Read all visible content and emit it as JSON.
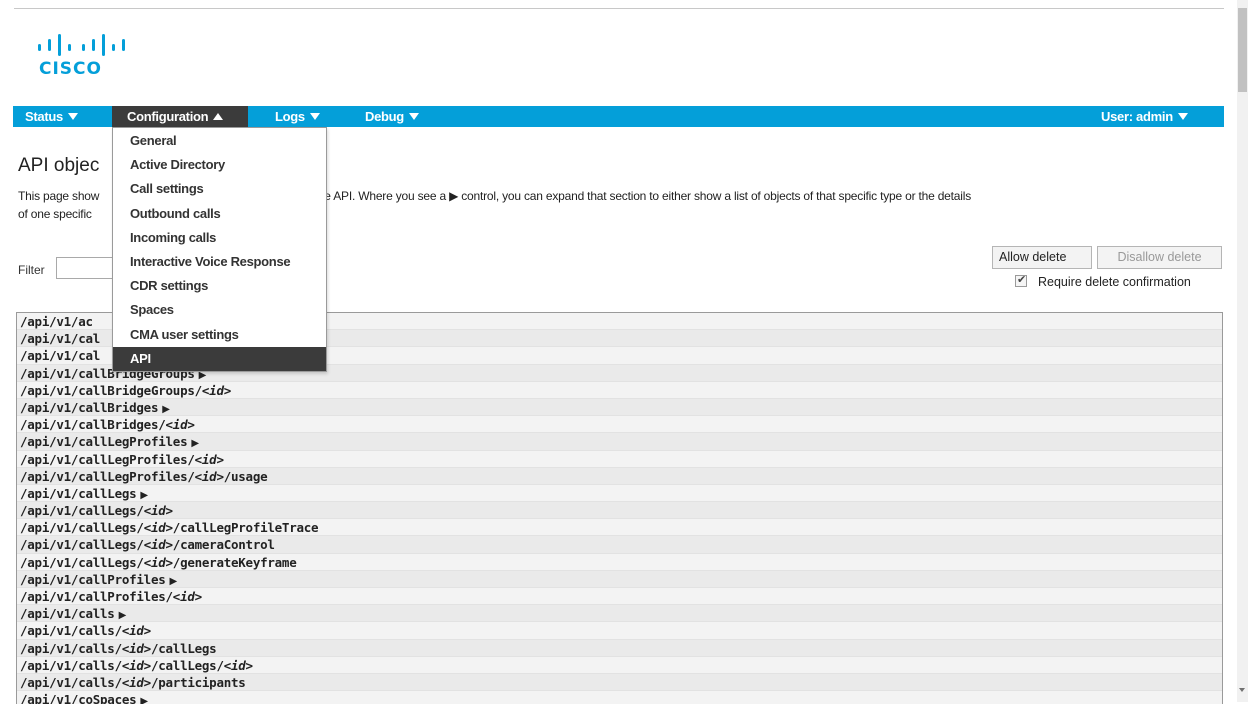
{
  "brand": {
    "logo_text": "CISCO",
    "color": "#049fd9"
  },
  "nav": {
    "status": "Status",
    "configuration": "Configuration",
    "logs": "Logs",
    "debug": "Debug",
    "user": "User: admin"
  },
  "menu": {
    "items": [
      "General",
      "Active Directory",
      "Call settings",
      "Outbound calls",
      "Incoming calls",
      "Interactive Voice Response",
      "CDR settings",
      "Spaces",
      "CMA user settings",
      "API"
    ],
    "active": "API"
  },
  "page": {
    "title": "API objec",
    "desc_left1": "This page show",
    "desc_right1": "by the API. Where you see a ▶ control, you can expand that section to either show a list of objects of that specific type or the details",
    "desc_left2": "of one specific"
  },
  "filter": {
    "label": "Filter",
    "value": ""
  },
  "buttons": {
    "allow_delete": "Allow delete",
    "disallow_delete": "Disallow delete"
  },
  "confirm": {
    "label": "Require delete confirmation",
    "checked": true
  },
  "api_rows": [
    {
      "text": "/api/v1/ac",
      "expandable": false
    },
    {
      "text": "/api/v1/cal",
      "expandable": false
    },
    {
      "text": "/api/v1/cal",
      "expandable": false
    },
    {
      "text": "/api/v1/callBridgeGroups",
      "expandable": true
    },
    {
      "text": "/api/v1/callBridgeGroups/",
      "id": "<id>",
      "after": "",
      "expandable": false
    },
    {
      "text": "/api/v1/callBridges",
      "expandable": true
    },
    {
      "text": "/api/v1/callBridges/",
      "id": "<id>",
      "after": "",
      "expandable": false
    },
    {
      "text": "/api/v1/callLegProfiles",
      "expandable": true
    },
    {
      "text": "/api/v1/callLegProfiles/",
      "id": "<id>",
      "after": "",
      "expandable": false
    },
    {
      "text": "/api/v1/callLegProfiles/",
      "id": "<id>",
      "after": "/usage",
      "expandable": false
    },
    {
      "text": "/api/v1/callLegs",
      "expandable": true
    },
    {
      "text": "/api/v1/callLegs/",
      "id": "<id>",
      "after": "",
      "expandable": false
    },
    {
      "text": "/api/v1/callLegs/",
      "id": "<id>",
      "after": "/callLegProfileTrace",
      "expandable": false
    },
    {
      "text": "/api/v1/callLegs/",
      "id": "<id>",
      "after": "/cameraControl",
      "expandable": false
    },
    {
      "text": "/api/v1/callLegs/",
      "id": "<id>",
      "after": "/generateKeyframe",
      "expandable": false
    },
    {
      "text": "/api/v1/callProfiles",
      "expandable": true
    },
    {
      "text": "/api/v1/callProfiles/",
      "id": "<id>",
      "after": "",
      "expandable": false
    },
    {
      "text": "/api/v1/calls",
      "expandable": true
    },
    {
      "text": "/api/v1/calls/",
      "id": "<id>",
      "after": "",
      "expandable": false
    },
    {
      "text": "/api/v1/calls/",
      "id": "<id>",
      "after": "/callLegs",
      "expandable": false
    },
    {
      "text": "/api/v1/calls/",
      "id": "<id>",
      "after": "/callLegs/",
      "id2": "<id>",
      "expandable": false
    },
    {
      "text": "/api/v1/calls/",
      "id": "<id>",
      "after": "/participants",
      "expandable": false
    },
    {
      "text": "/api/v1/coSpaces",
      "expandable": true
    }
  ]
}
